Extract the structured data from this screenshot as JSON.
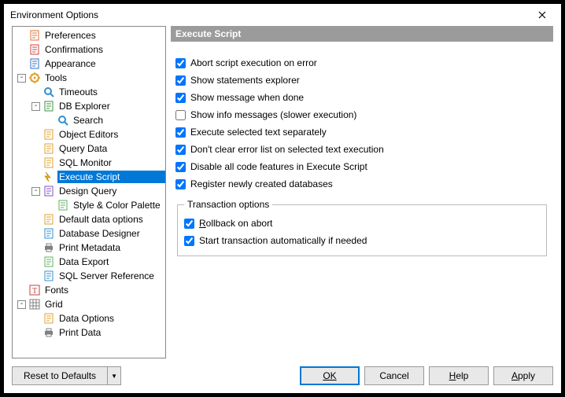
{
  "window": {
    "title": "Environment Options"
  },
  "tree": [
    {
      "level": 0,
      "toggle": "",
      "icon": "pref",
      "label": "Preferences"
    },
    {
      "level": 0,
      "toggle": "",
      "icon": "confirm",
      "label": "Confirmations"
    },
    {
      "level": 0,
      "toggle": "",
      "icon": "appearance",
      "label": "Appearance"
    },
    {
      "level": 0,
      "toggle": "-",
      "icon": "tools",
      "label": "Tools"
    },
    {
      "level": 1,
      "toggle": "",
      "icon": "timeouts",
      "label": "Timeouts"
    },
    {
      "level": 1,
      "toggle": "-",
      "icon": "dbexplorer",
      "label": "DB Explorer"
    },
    {
      "level": 2,
      "toggle": "",
      "icon": "search",
      "label": "Search"
    },
    {
      "level": 1,
      "toggle": "",
      "icon": "objeditors",
      "label": "Object Editors"
    },
    {
      "level": 1,
      "toggle": "",
      "icon": "querydata",
      "label": "Query Data"
    },
    {
      "level": 1,
      "toggle": "",
      "icon": "sqlmonitor",
      "label": "SQL Monitor"
    },
    {
      "level": 1,
      "toggle": "",
      "icon": "exec",
      "label": "Execute Script",
      "selected": true
    },
    {
      "level": 1,
      "toggle": "-",
      "icon": "design",
      "label": "Design Query"
    },
    {
      "level": 2,
      "toggle": "",
      "icon": "palette",
      "label": "Style & Color Palette"
    },
    {
      "level": 1,
      "toggle": "",
      "icon": "defaults",
      "label": "Default data options"
    },
    {
      "level": 1,
      "toggle": "",
      "icon": "dbdesign",
      "label": "Database Designer"
    },
    {
      "level": 1,
      "toggle": "",
      "icon": "print",
      "label": "Print Metadata"
    },
    {
      "level": 1,
      "toggle": "",
      "icon": "export",
      "label": "Data Export"
    },
    {
      "level": 1,
      "toggle": "",
      "icon": "sqlref",
      "label": "SQL Server Reference"
    },
    {
      "level": 0,
      "toggle": "",
      "icon": "fonts",
      "label": "Fonts"
    },
    {
      "level": 0,
      "toggle": "-",
      "icon": "grid",
      "label": "Grid"
    },
    {
      "level": 1,
      "toggle": "",
      "icon": "dataopt",
      "label": "Data Options"
    },
    {
      "level": 1,
      "toggle": "",
      "icon": "printdata",
      "label": "Print Data"
    }
  ],
  "panel": {
    "title": "Execute Script",
    "options": [
      {
        "key": "abort",
        "label": "Abort script execution on error",
        "checked": true
      },
      {
        "key": "show_stmt",
        "label": "Show statements explorer",
        "checked": true
      },
      {
        "key": "show_msg",
        "label": "Show message when done",
        "checked": true
      },
      {
        "key": "show_info",
        "label": "Show info messages (slower execution)",
        "checked": false
      },
      {
        "key": "exec_sel",
        "label": "Execute selected text separately",
        "checked": true
      },
      {
        "key": "no_clear",
        "label": "Don't clear error list on selected text execution",
        "checked": true
      },
      {
        "key": "disable_feat",
        "label": "Disable all code features in Execute Script",
        "checked": true
      },
      {
        "key": "register_db",
        "label": "Register newly created databases",
        "checked": true
      }
    ],
    "transaction": {
      "legend": "Transaction options",
      "options": [
        {
          "key": "rollback",
          "label": "Rollback on abort",
          "checked": true,
          "underline": true
        },
        {
          "key": "auto_tx",
          "label": "Start transaction automatically if needed",
          "checked": true
        }
      ]
    }
  },
  "footer": {
    "reset": "Reset to Defaults",
    "ok": "OK",
    "cancel": "Cancel",
    "help": "Help",
    "apply": "Apply"
  },
  "icons": {
    "pref": "#e07030",
    "confirm": "#d04040",
    "appearance": "#3070c0",
    "tools": "#e0a030",
    "timeouts": "#3090d0",
    "dbexplorer": "#409040",
    "search": "#3090d0",
    "objeditors": "#e0a030",
    "querydata": "#e0a030",
    "sqlmonitor": "#e0a030",
    "exec": "#e0a030",
    "design": "#8050c0",
    "palette": "#60b060",
    "defaults": "#e0a030",
    "dbdesign": "#3090d0",
    "print": "#808080",
    "export": "#60b060",
    "sqlref": "#3090d0",
    "fonts": "#c04040",
    "grid": "#808080",
    "dataopt": "#e0a030",
    "printdata": "#808080"
  }
}
